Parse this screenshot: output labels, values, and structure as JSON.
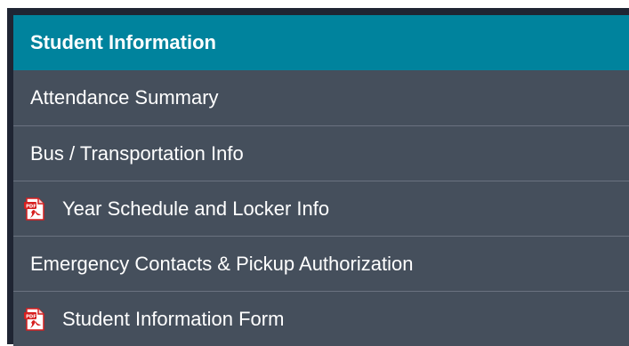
{
  "menu": {
    "header": {
      "label": "Student Information"
    },
    "items": [
      {
        "label": "Attendance Summary",
        "icon": null
      },
      {
        "label": "Bus / Transportation Info",
        "icon": null
      },
      {
        "label": "Year Schedule and Locker Info",
        "icon": "pdf-icon"
      },
      {
        "label": "Emergency Contacts & Pickup Authorization",
        "icon": null
      },
      {
        "label": "Student Information Form",
        "icon": "pdf-icon"
      }
    ]
  },
  "colors": {
    "frame": "#1f2533",
    "header": "#00839d",
    "item": "#454f5c",
    "divider": "#6a7280",
    "text": "#ffffff",
    "pdf_red": "#d71f1f"
  }
}
